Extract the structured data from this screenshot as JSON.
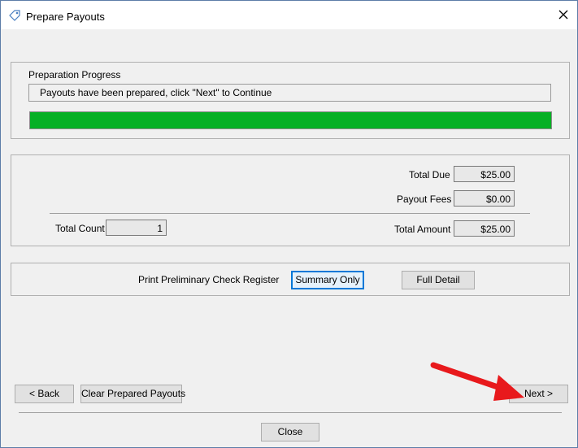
{
  "window": {
    "title": "Prepare Payouts"
  },
  "progress": {
    "group_label": "Preparation Progress",
    "status_text": "Payouts have been prepared, click \"Next\" to Continue",
    "percent": 100,
    "bar_color": "#06b025"
  },
  "totals": {
    "total_due_label": "Total Due",
    "total_due_value": "$25.00",
    "payout_fees_label": "Payout Fees",
    "payout_fees_value": "$0.00",
    "total_count_label": "Total Count",
    "total_count_value": "1",
    "total_amount_label": "Total Amount",
    "total_amount_value": "$25.00"
  },
  "register": {
    "label": "Print Preliminary Check Register",
    "summary_button": "Summary Only",
    "full_button": "Full Detail"
  },
  "nav": {
    "back_button": "< Back",
    "clear_button": "Clear Prepared Payouts",
    "next_button": "Next >",
    "close_button": "Close"
  },
  "annotation": {
    "arrow_color": "#e8191c"
  }
}
